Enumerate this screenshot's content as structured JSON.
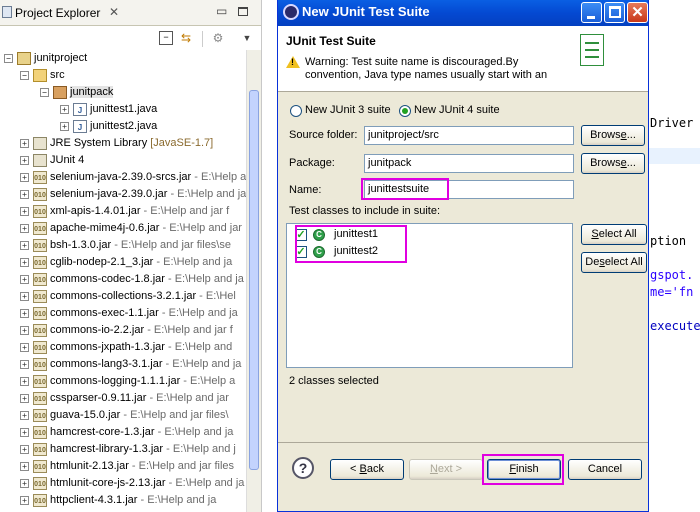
{
  "explorer": {
    "title": "Project Explorer",
    "close_glyph": "✕",
    "tree": [
      {
        "label": "junitproject",
        "hint": "",
        "path": "",
        "icon": "project-icon",
        "expander": "−"
      },
      {
        "label": "src",
        "hint": "",
        "path": "",
        "icon": "source-folder-icon",
        "expander": "−"
      },
      {
        "label": "junitpack",
        "hint": "",
        "path": "",
        "icon": "package-icon",
        "expander": "−"
      },
      {
        "label": "junittest1.java",
        "hint": "",
        "path": "",
        "icon": "java-file-icon",
        "expander": "+"
      },
      {
        "label": "junittest2.java",
        "hint": "",
        "path": "",
        "icon": "java-file-icon",
        "expander": "+"
      },
      {
        "label": "JRE System Library ",
        "hint": "[JavaSE-1.7]",
        "path": "",
        "icon": "library-icon",
        "expander": "+"
      },
      {
        "label": "JUnit 4",
        "hint": "",
        "path": "",
        "icon": "library-icon",
        "expander": "+"
      },
      {
        "label": "selenium-java-2.39.0-srcs.jar",
        "hint": "",
        "path": " - E:\\Help and jar files\\se",
        "icon": "jar-icon",
        "expander": "+"
      },
      {
        "label": "selenium-java-2.39.0.jar",
        "hint": "",
        "path": " - E:\\Help and jar files\\se",
        "icon": "jar-icon",
        "expander": "+"
      },
      {
        "label": "xml-apis-1.4.01.jar",
        "hint": "",
        "path": " - E:\\Help and jar f",
        "icon": "jar-icon",
        "expander": "+"
      },
      {
        "label": "apache-mime4j-0.6.jar",
        "hint": "",
        "path": " - E:\\Help and jar",
        "icon": "jar-icon",
        "expander": "+"
      },
      {
        "label": "bsh-1.3.0.jar",
        "hint": "",
        "path": " - E:\\Help and jar files\\se",
        "icon": "jar-icon",
        "expander": "+"
      },
      {
        "label": "cglib-nodep-2.1_3.jar",
        "hint": "",
        "path": " - E:\\Help and ja",
        "icon": "jar-icon",
        "expander": "+"
      },
      {
        "label": "commons-codec-1.8.jar",
        "hint": "",
        "path": " - E:\\Help and ja",
        "icon": "jar-icon",
        "expander": "+"
      },
      {
        "label": "commons-collections-3.2.1.jar",
        "hint": "",
        "path": " - E:\\Hel",
        "icon": "jar-icon",
        "expander": "+"
      },
      {
        "label": "commons-exec-1.1.jar",
        "hint": "",
        "path": " - E:\\Help and ja",
        "icon": "jar-icon",
        "expander": "+"
      },
      {
        "label": "commons-io-2.2.jar",
        "hint": "",
        "path": " - E:\\Help and jar f",
        "icon": "jar-icon",
        "expander": "+"
      },
      {
        "label": "commons-jxpath-1.3.jar",
        "hint": "",
        "path": " - E:\\Help and",
        "icon": "jar-icon",
        "expander": "+"
      },
      {
        "label": "commons-lang3-3.1.jar",
        "hint": "",
        "path": " - E:\\Help and ja",
        "icon": "jar-icon",
        "expander": "+"
      },
      {
        "label": "commons-logging-1.1.1.jar",
        "hint": "",
        "path": " - E:\\Help a",
        "icon": "jar-icon",
        "expander": "+"
      },
      {
        "label": "cssparser-0.9.11.jar",
        "hint": "",
        "path": " - E:\\Help and jar",
        "icon": "jar-icon",
        "expander": "+"
      },
      {
        "label": "guava-15.0.jar",
        "hint": "",
        "path": " - E:\\Help and jar files\\",
        "icon": "jar-icon",
        "expander": "+"
      },
      {
        "label": "hamcrest-core-1.3.jar",
        "hint": "",
        "path": " - E:\\Help and ja",
        "icon": "jar-icon",
        "expander": "+"
      },
      {
        "label": "hamcrest-library-1.3.jar",
        "hint": "",
        "path": " - E:\\Help and j",
        "icon": "jar-icon",
        "expander": "+"
      },
      {
        "label": "htmlunit-2.13.jar",
        "hint": "",
        "path": " - E:\\Help and jar files",
        "icon": "jar-icon",
        "expander": "+"
      },
      {
        "label": "htmlunit-core-js-2.13.jar",
        "hint": "",
        "path": " - E:\\Help and ja",
        "icon": "jar-icon",
        "expander": "+"
      },
      {
        "label": "httpclient-4.3.1.jar",
        "hint": "",
        "path": " - E:\\Help and ja",
        "icon": "jar-icon",
        "expander": "+"
      }
    ]
  },
  "editor": {
    "lines": [
      "Driver",
      "ption",
      "gspot.",
      "me='fn",
      "execute"
    ]
  },
  "dialog": {
    "title": "New JUnit Test Suite",
    "header_title": "JUnit Test Suite",
    "warning": "Warning: Test suite name is discouraged.By convention, Java type names usually start with an",
    "radio_junit3": "New JUnit 3 suite",
    "radio_junit4": "New JUnit 4 suite",
    "selected_version": "junit4",
    "source_folder_label": "Source folder:",
    "source_folder_value": "junitproject/src",
    "package_label": "Package:",
    "package_value": "junitpack",
    "name_label": "Name:",
    "name_value": "junittestsuite",
    "browse_label": "Browse...",
    "classes_label": "Test classes to include in suite:",
    "classes": [
      {
        "name": "junittest1",
        "checked": true
      },
      {
        "name": "junittest2",
        "checked": true
      }
    ],
    "select_all": "Select All",
    "deselect_all": "Deselect All",
    "status": "2 classes selected",
    "help_glyph": "?",
    "back": "< Back",
    "next": "Next >",
    "finish": "Finish",
    "cancel": "Cancel"
  }
}
